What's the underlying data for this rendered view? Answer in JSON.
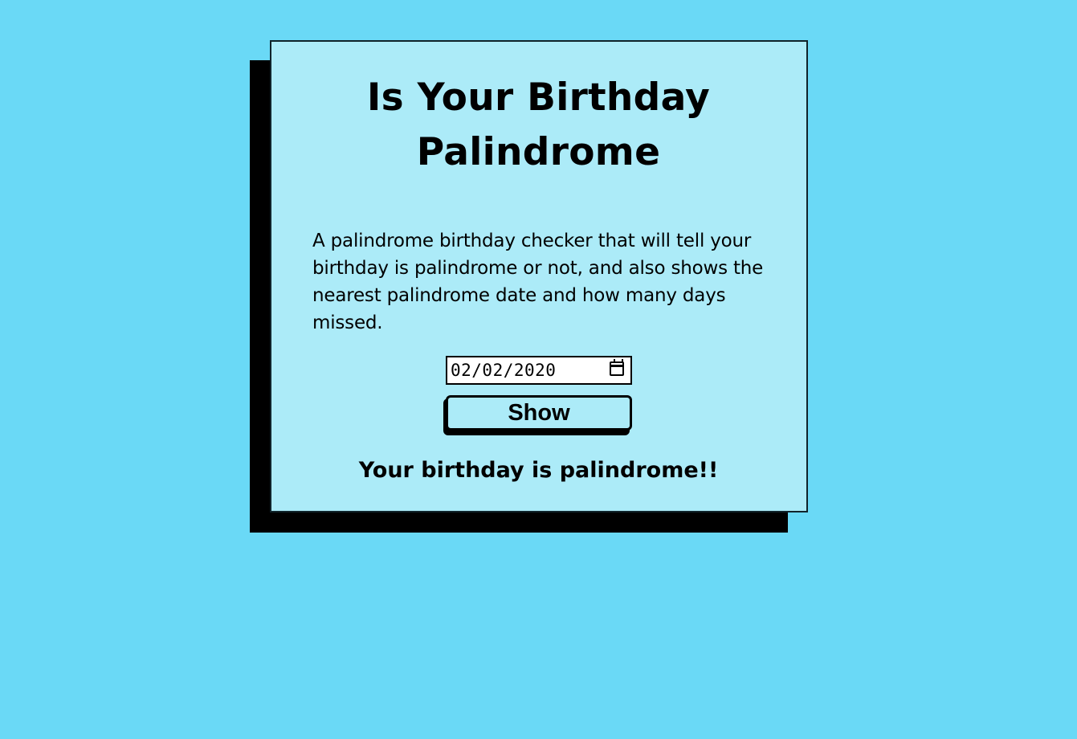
{
  "page": {
    "background_color": "#6ad9f6",
    "card_color": "#acebf8"
  },
  "header": {
    "title_line1": "Is Your Birthday",
    "title_line2": "Palindrome"
  },
  "description": "A palindrome birthday checker that will tell your birthday is palindrome or not, and also shows the nearest palindrome date and how many days missed.",
  "form": {
    "date_value": "02/02/2020",
    "calendar_icon": "calendar-icon",
    "show_label": "Show"
  },
  "result": {
    "message": "Your birthday is palindrome!!"
  }
}
